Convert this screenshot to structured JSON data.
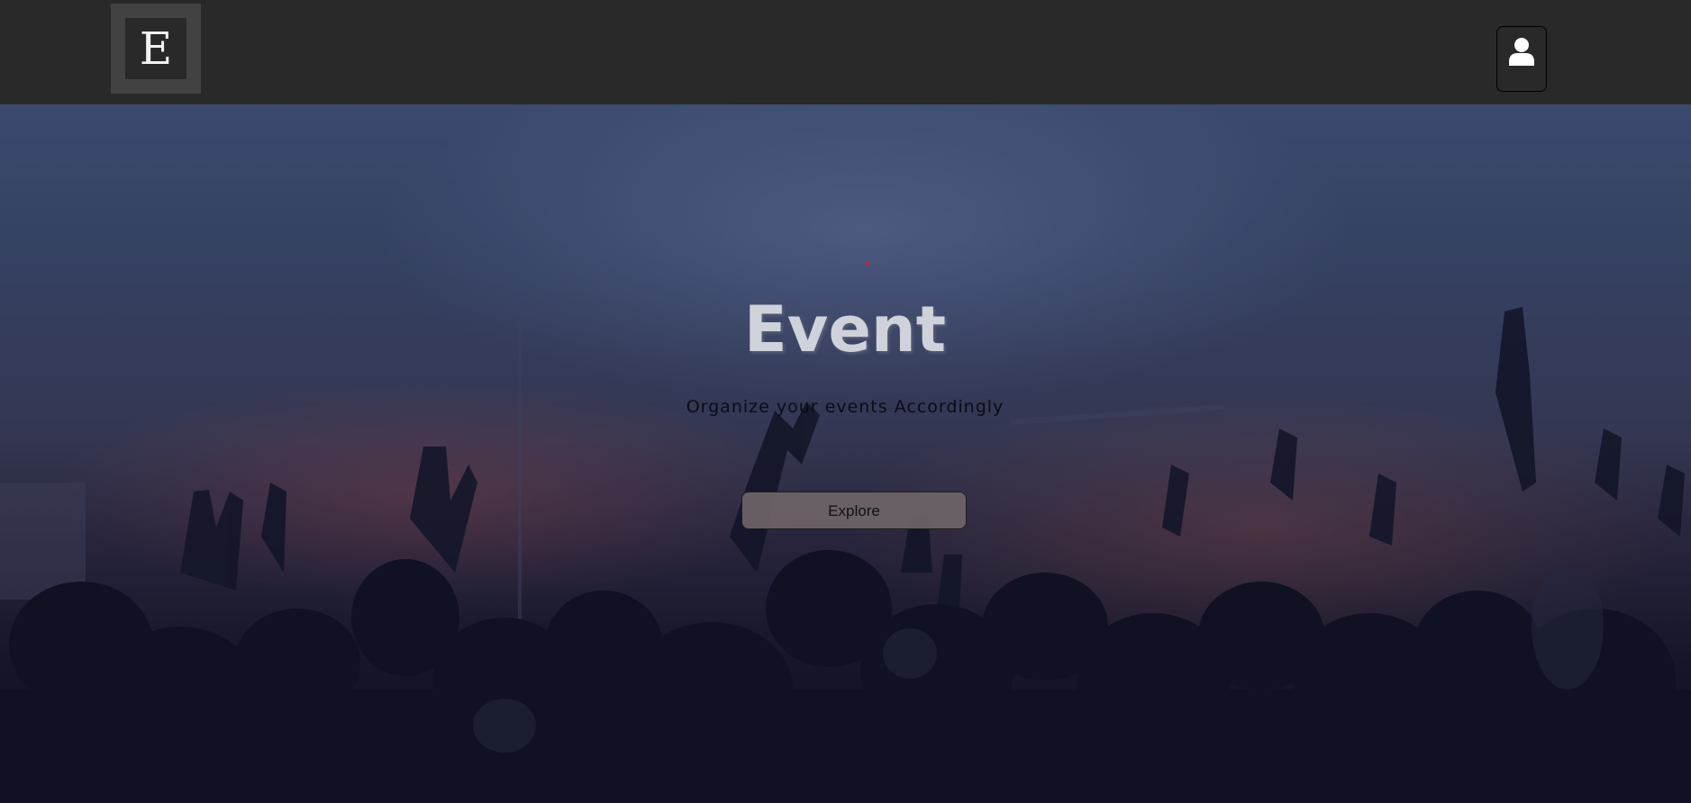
{
  "header": {
    "logo_letter": "E",
    "logo_icon": "letter-e-logo",
    "user_icon": "user-icon",
    "background_color": "#292929"
  },
  "hero": {
    "title": "Event",
    "subtitle": "Organize your events Accordingly",
    "explore_label": "Explore",
    "background_image": "concert-crowd-photo",
    "accent_dot_color": "#d61e2a"
  }
}
